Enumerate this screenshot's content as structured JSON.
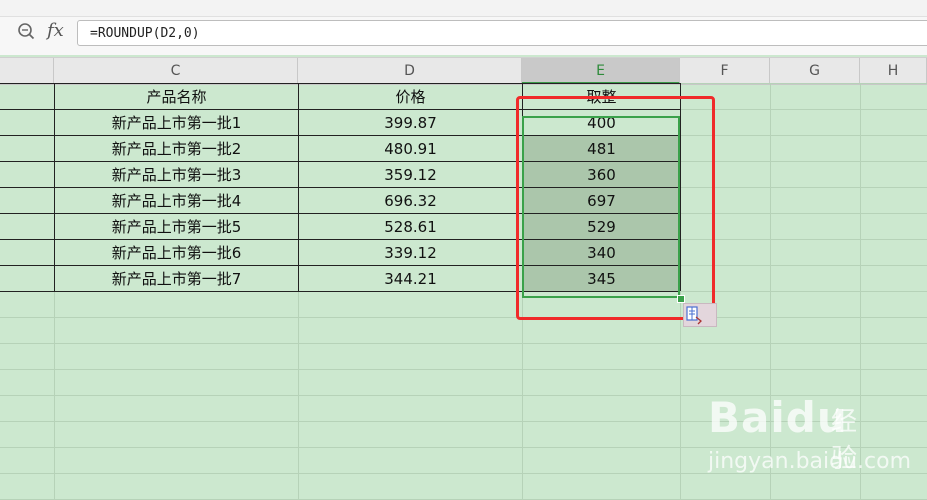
{
  "formula_bar": {
    "fx_label": "fx",
    "formula": "=ROUNDUP(D2,0)"
  },
  "columns": [
    {
      "label": "C",
      "active": false
    },
    {
      "label": "D",
      "active": false
    },
    {
      "label": "E",
      "active": true
    },
    {
      "label": "F",
      "active": false
    },
    {
      "label": "G",
      "active": false
    },
    {
      "label": "H",
      "active": false
    }
  ],
  "table": {
    "headers": [
      "产品名称",
      "价格",
      "取整"
    ],
    "rows": [
      [
        "新产品上市第一批1",
        "399.87",
        "400"
      ],
      [
        "新产品上市第一批2",
        "480.91",
        "481"
      ],
      [
        "新产品上市第一批3",
        "359.12",
        "360"
      ],
      [
        "新产品上市第一批4",
        "696.32",
        "697"
      ],
      [
        "新产品上市第一批5",
        "528.61",
        "529"
      ],
      [
        "新产品上市第一批6",
        "339.12",
        "340"
      ],
      [
        "新产品上市第一批7",
        "344.21",
        "345"
      ]
    ]
  },
  "watermark": {
    "brand": "Baidu",
    "suffix": "经验",
    "url": "jingyan.baidu.com"
  },
  "colors": {
    "sheet_bg": "#cce8cf",
    "selection": "#3aa14a",
    "annotation": "#f02a2a",
    "selected_fill": "#abc6ab"
  }
}
